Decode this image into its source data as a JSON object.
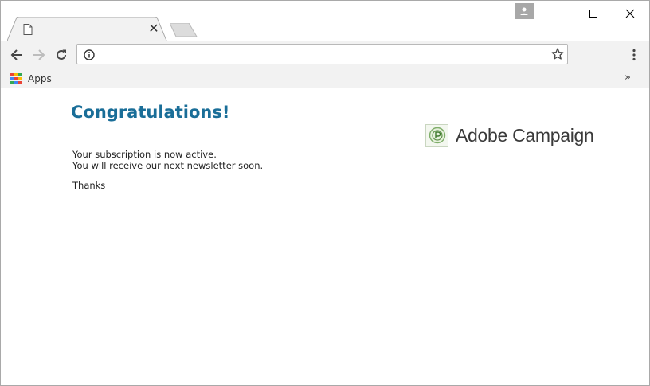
{
  "browser": {
    "tab": {
      "title": "",
      "close_glyph": "✕",
      "page_icon": "page-icon"
    },
    "window_controls": {
      "minimize": "minimize-icon",
      "maximize": "maximize-icon",
      "close": "close-icon"
    },
    "address_bar": {
      "url": "",
      "info_icon": "info-icon",
      "star_icon": "star-icon"
    },
    "bookmarks_bar": {
      "apps_label": "Apps",
      "apps_colors": [
        "#ea4335",
        "#fbbc05",
        "#34a853",
        "#4285f4",
        "#ea4335",
        "#fbbc05",
        "#34a853",
        "#4285f4",
        "#ea4335"
      ],
      "more_glyph": "»"
    }
  },
  "page": {
    "heading": "Congratulations!",
    "message_lines": [
      "Your subscription is now active.",
      "You will receive our next newsletter soon."
    ],
    "signoff": "Thanks",
    "brand": "Adobe Campaign",
    "heading_color": "#1a6e98"
  }
}
